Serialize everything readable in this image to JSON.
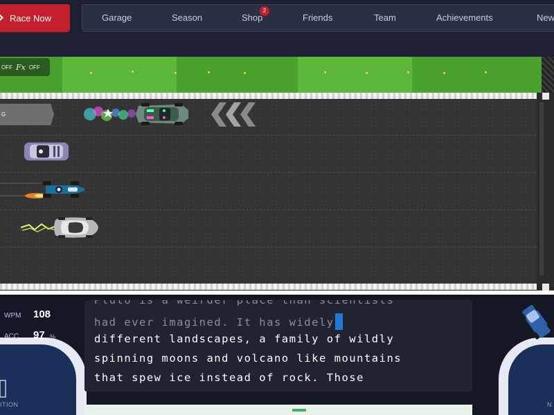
{
  "nav": {
    "race_now": "Race Now",
    "items": [
      {
        "label": "Garage"
      },
      {
        "label": "Season"
      },
      {
        "label": "Shop",
        "badge": "2"
      },
      {
        "label": "Friends"
      },
      {
        "label": "Team"
      },
      {
        "label": "Achievements"
      },
      {
        "label": "New"
      }
    ]
  },
  "fx_panel": {
    "sound_state": "OFF",
    "fx_label": "Fx",
    "fx_state": "OFF"
  },
  "race": {
    "player_tag": "G"
  },
  "stats": {
    "wpm_label": "WPM",
    "wpm_value": "108",
    "acc_label": "ACC",
    "acc_value": "97",
    "acc_unit": "%"
  },
  "typing": {
    "line1": "Pluto is a weirder place than scientists",
    "line2_typed": "had ever imagined. It has widely",
    "line3": "different landscapes, a family of wildly",
    "line4": "spinning moons and volcano like mountains",
    "line5": "that spew ice instead of rock. Those"
  },
  "console": {
    "left_label": "ITION",
    "right_label": "N"
  },
  "colors": {
    "accent_red": "#c4202c",
    "cursor_blue": "#1f7ad6",
    "grass": "#4aa12d"
  }
}
